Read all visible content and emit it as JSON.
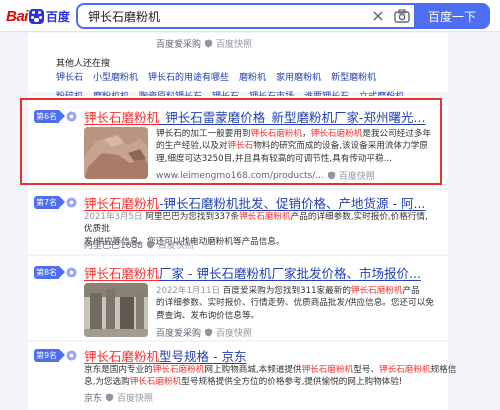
{
  "header": {
    "logo_bai": "Bai",
    "logo_du": "百度",
    "search_value": "钾长石磨粉机",
    "search_button": "百度一下"
  },
  "top_meta": {
    "source": "百度爱采购",
    "snapshot": "百度快照"
  },
  "related": {
    "title": "其他人还在搜",
    "rows": [
      [
        "钾长石",
        "小型磨粉机",
        "钾长石的用途有哪些",
        "磨粉机",
        "家用磨粉机",
        "新型磨粉机"
      ],
      [
        "粉碎机",
        "磨粉机机",
        "陶瓷原料钾长石",
        "钾长石",
        "钾长石市场",
        "谁要钾长石",
        "立式磨粉机"
      ]
    ]
  },
  "results": [
    {
      "rank": "第6名",
      "title_em": "钾长石磨粉机",
      "title_rest": "_钾长石雷蒙磨价格_新型磨粉机厂家-郑州曙光...",
      "snippet_l1_a": "钾长石的加工一般要用到",
      "snippet_l1_em1": "钾长石磨粉机",
      "snippet_l1_b": "，",
      "snippet_l1_em2": "钾长石磨粉机",
      "snippet_l1_c": "是我公司经过多年",
      "snippet_l2_a": "的生产经验,以及对",
      "snippet_l2_em": "钾长石",
      "snippet_l2_b": "物料的研究而成的设备,该设备采用流体力学原",
      "snippet_l3": "理,细度可达3250目,并且具有较高的可调节性,具有传动平稳...",
      "url": "www.leimengmo168.com/products/...",
      "snapshot": "百度快照"
    },
    {
      "rank": "第7名",
      "title_em": "钾长石磨粉机",
      "title_rest": "-钾长石磨粉机批发、促销价格、产地货源 - 阿...",
      "snippet_date": "2021年3月5日",
      "snippet_l1_a": "阿里巴巴为您找到337条",
      "snippet_l1_em": "钾长石磨粉机",
      "snippet_l1_b": "产品的详细参数,实时报价,价格行情,优质批",
      "snippet_l2": "发/供应等信息。您还可以找电动磨粉机等产品信息。",
      "source": "阿里巴巴1688",
      "snapshot": "百度快照"
    },
    {
      "rank": "第8名",
      "title_em": "钾长石磨粉机",
      "title_rest": "厂家 - 钾长石磨粉机厂家批发价格、市场报价...",
      "snippet_date": "2022年1月11日",
      "snippet_l1_a": "百度爱采购为您找到311家最新的",
      "snippet_l1_em": "钾长石磨粉机",
      "snippet_l1_b": "产品",
      "snippet_l2": "的详细参数、实时报价、行情走势、优质商品批发/供应信息。您还可以免",
      "snippet_l3": "费查询、发布询价信息等。",
      "source": "百度爱采购",
      "snapshot": "百度快照"
    },
    {
      "rank": "第9名",
      "title_em": "钾长石磨粉机",
      "title_rest": "型号规格 - 京东",
      "snippet_l1_a": "京东是国内专业的",
      "snippet_l1_em": "钾长石磨粉机",
      "snippet_l1_b": "网上购物商城,本频道提供",
      "snippet_l1_em2": "钾长石磨粉机",
      "snippet_l1_c": "型号、",
      "snippet_l1_em3": "钾长石磨粉机",
      "snippet_l1_d": "规格信",
      "snippet_l2_a": "息,为您选购",
      "snippet_l2_em": "钾长石磨粉机",
      "snippet_l2_b": "型号规格提供全方位的价格参考,提供愉悦的网上购物体验!",
      "source": "京东",
      "snapshot": "百度快照"
    }
  ]
}
